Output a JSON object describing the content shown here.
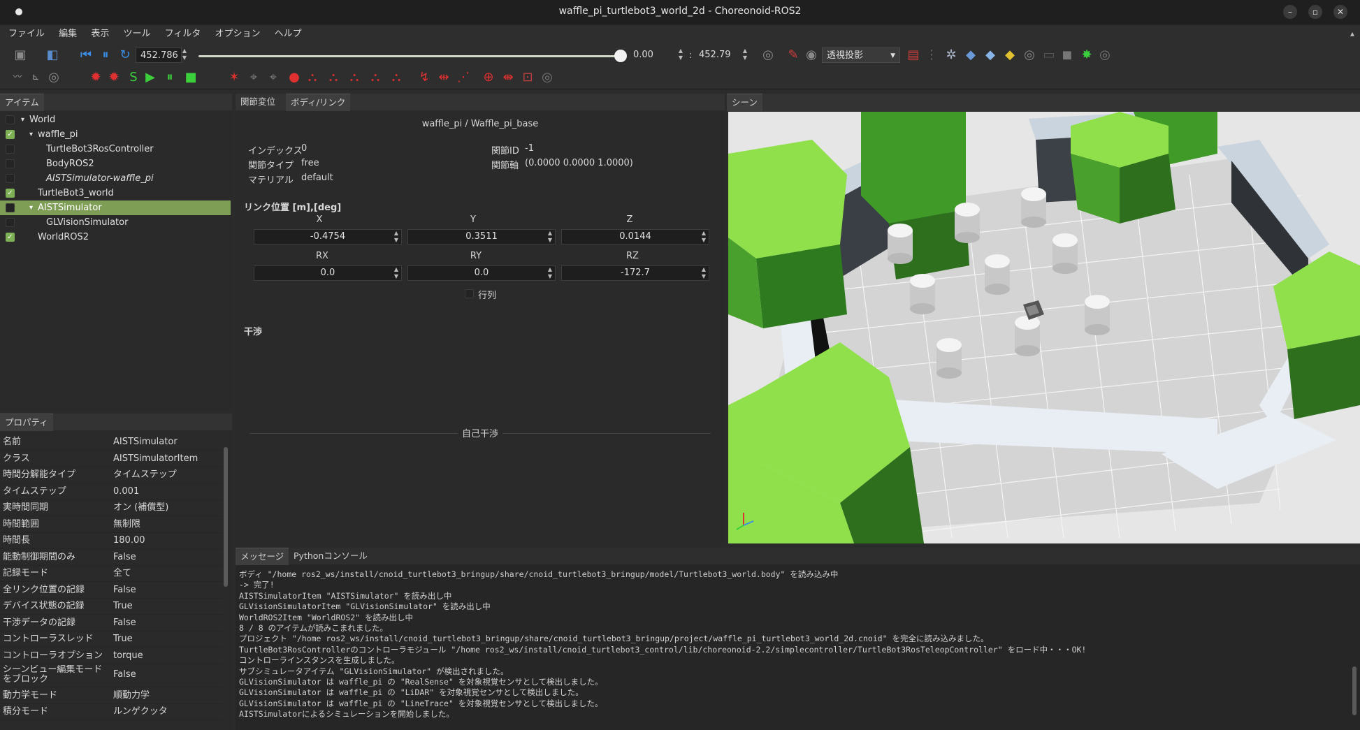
{
  "window": {
    "title": "waffle_pi_turtlebot3_world_2d - Choreonoid-ROS2",
    "minimize": "–",
    "maximize": "▫",
    "close": "✕"
  },
  "menu": [
    "ファイル",
    "編集",
    "表示",
    "ツール",
    "フィルタ",
    "オプション",
    "ヘルプ"
  ],
  "toolbar": {
    "time_value": "452.786",
    "slider_fraction": 1.0,
    "range_start": "0.00",
    "range_end": "452.79",
    "projection": "透視投影"
  },
  "items_panel": {
    "tab": "アイテム",
    "tree": [
      {
        "label": "World",
        "indent": 0,
        "arrow": "▾",
        "checked": false
      },
      {
        "label": "waffle_pi",
        "indent": 1,
        "arrow": "▾",
        "checked": true
      },
      {
        "label": "TurtleBot3RosController",
        "indent": 2,
        "arrow": "",
        "checked": false
      },
      {
        "label": "BodyROS2",
        "indent": 2,
        "arrow": "",
        "checked": false
      },
      {
        "label": "AISTSimulator-waffle_pi",
        "indent": 2,
        "arrow": "",
        "checked": false,
        "italic": true
      },
      {
        "label": "TurtleBot3_world",
        "indent": 1,
        "arrow": "",
        "checked": true
      },
      {
        "label": "AISTSimulator",
        "indent": 1,
        "arrow": "▾",
        "checked": false,
        "selected": true
      },
      {
        "label": "GLVisionSimulator",
        "indent": 2,
        "arrow": "",
        "checked": false
      },
      {
        "label": "WorldROS2",
        "indent": 1,
        "arrow": "",
        "checked": true
      }
    ]
  },
  "properties": {
    "tab": "プロパティ",
    "rows": [
      [
        "名前",
        "AISTSimulator"
      ],
      [
        "クラス",
        "AISTSimulatorItem"
      ],
      [
        "時間分解能タイプ",
        "タイムステップ"
      ],
      [
        "タイムステップ",
        "0.001"
      ],
      [
        "実時間同期",
        "オン (補償型)"
      ],
      [
        "時間範囲",
        "無制限"
      ],
      [
        "時間長",
        "180.00"
      ],
      [
        "能動制御期間のみ",
        "False"
      ],
      [
        "記録モード",
        "全て"
      ],
      [
        "全リンク位置の記録",
        "False"
      ],
      [
        "デバイス状態の記録",
        "True"
      ],
      [
        "干渉データの記録",
        "False"
      ],
      [
        "コントローラスレッド",
        "True"
      ],
      [
        "コントローラオプション",
        "torque"
      ],
      [
        "シーンビュー編集モードをブロック",
        "False"
      ],
      [
        "動力学モード",
        "順動力学"
      ],
      [
        "積分モード",
        "ルンゲクッタ"
      ]
    ]
  },
  "link_panel": {
    "tabs": [
      "関節変位",
      "ボディ/リンク"
    ],
    "header": "waffle_pi / Waffle_pi_base",
    "index_label": "インデックス",
    "index_value": "0",
    "joint_id_label": "関節ID",
    "joint_id_value": "-1",
    "joint_type_label": "関節タイプ",
    "joint_type_value": "free",
    "joint_axis_label": "関節軸",
    "joint_axis_value": "(0.0000 0.0000 1.0000)",
    "material_label": "マテリアル",
    "material_value": "default",
    "position_title": "リンク位置 [m],[deg]",
    "x_label": "X",
    "y_label": "Y",
    "z_label": "Z",
    "x": "-0.4754",
    "y": "0.3511",
    "z": "0.0144",
    "rx_label": "RX",
    "ry_label": "RY",
    "rz_label": "RZ",
    "rx": "0.0",
    "ry": "0.0",
    "rz": "-172.7",
    "matrix_label": "行列",
    "collision_title": "干渉",
    "self_collision": "自己干渉"
  },
  "scene_panel": {
    "tab": "シーン"
  },
  "message_panel": {
    "tabs": [
      "メッセージ",
      "Pythonコンソール"
    ],
    "lines": [
      "ボディ \"/home          ros2_ws/install/cnoid_turtlebot3_bringup/share/cnoid_turtlebot3_bringup/model/Turtlebot3_world.body\" を読み込み中",
      " -> 完了!",
      "AISTSimulatorItem \"AISTSimulator\" を読み出し中",
      "GLVisionSimulatorItem \"GLVisionSimulator\" を読み出し中",
      "WorldROS2Item \"WorldROS2\" を読み出し中",
      "8 / 8 のアイテムが読みこまれました。",
      "プロジェクト \"/home          ros2_ws/install/cnoid_turtlebot3_bringup/share/cnoid_turtlebot3_bringup/project/waffle_pi_turtlebot3_world_2d.cnoid\" を完全に読み込みました。",
      "TurtleBot3RosControllerのコントローラモジュール \"/home          ros2_ws/install/cnoid_turtlebot3_control/lib/choreonoid-2.2/simplecontroller/TurtleBot3RosTeleopController\" をロード中・・・OK!",
      "コントローラインスタンスを生成しました。",
      "サブシミュレータアイテム \"GLVisionSimulator\" が検出されました。",
      "GLVisionSimulator は waffle_pi の \"RealSense\" を対象視覚センサとして検出しました。",
      "GLVisionSimulator は waffle_pi の \"LiDAR\" を対象視覚センサとして検出しました。",
      "GLVisionSimulator は waffle_pi の \"LineTrace\" を対象視覚センサとして検出しました。",
      "AISTSimulatorによるシミュレーションを開始しました。"
    ]
  },
  "colors": {
    "accent_green": "#7eb055",
    "selection": "#7e9d55",
    "play_blue": "#3a8ee6",
    "record_red": "#e03030"
  }
}
